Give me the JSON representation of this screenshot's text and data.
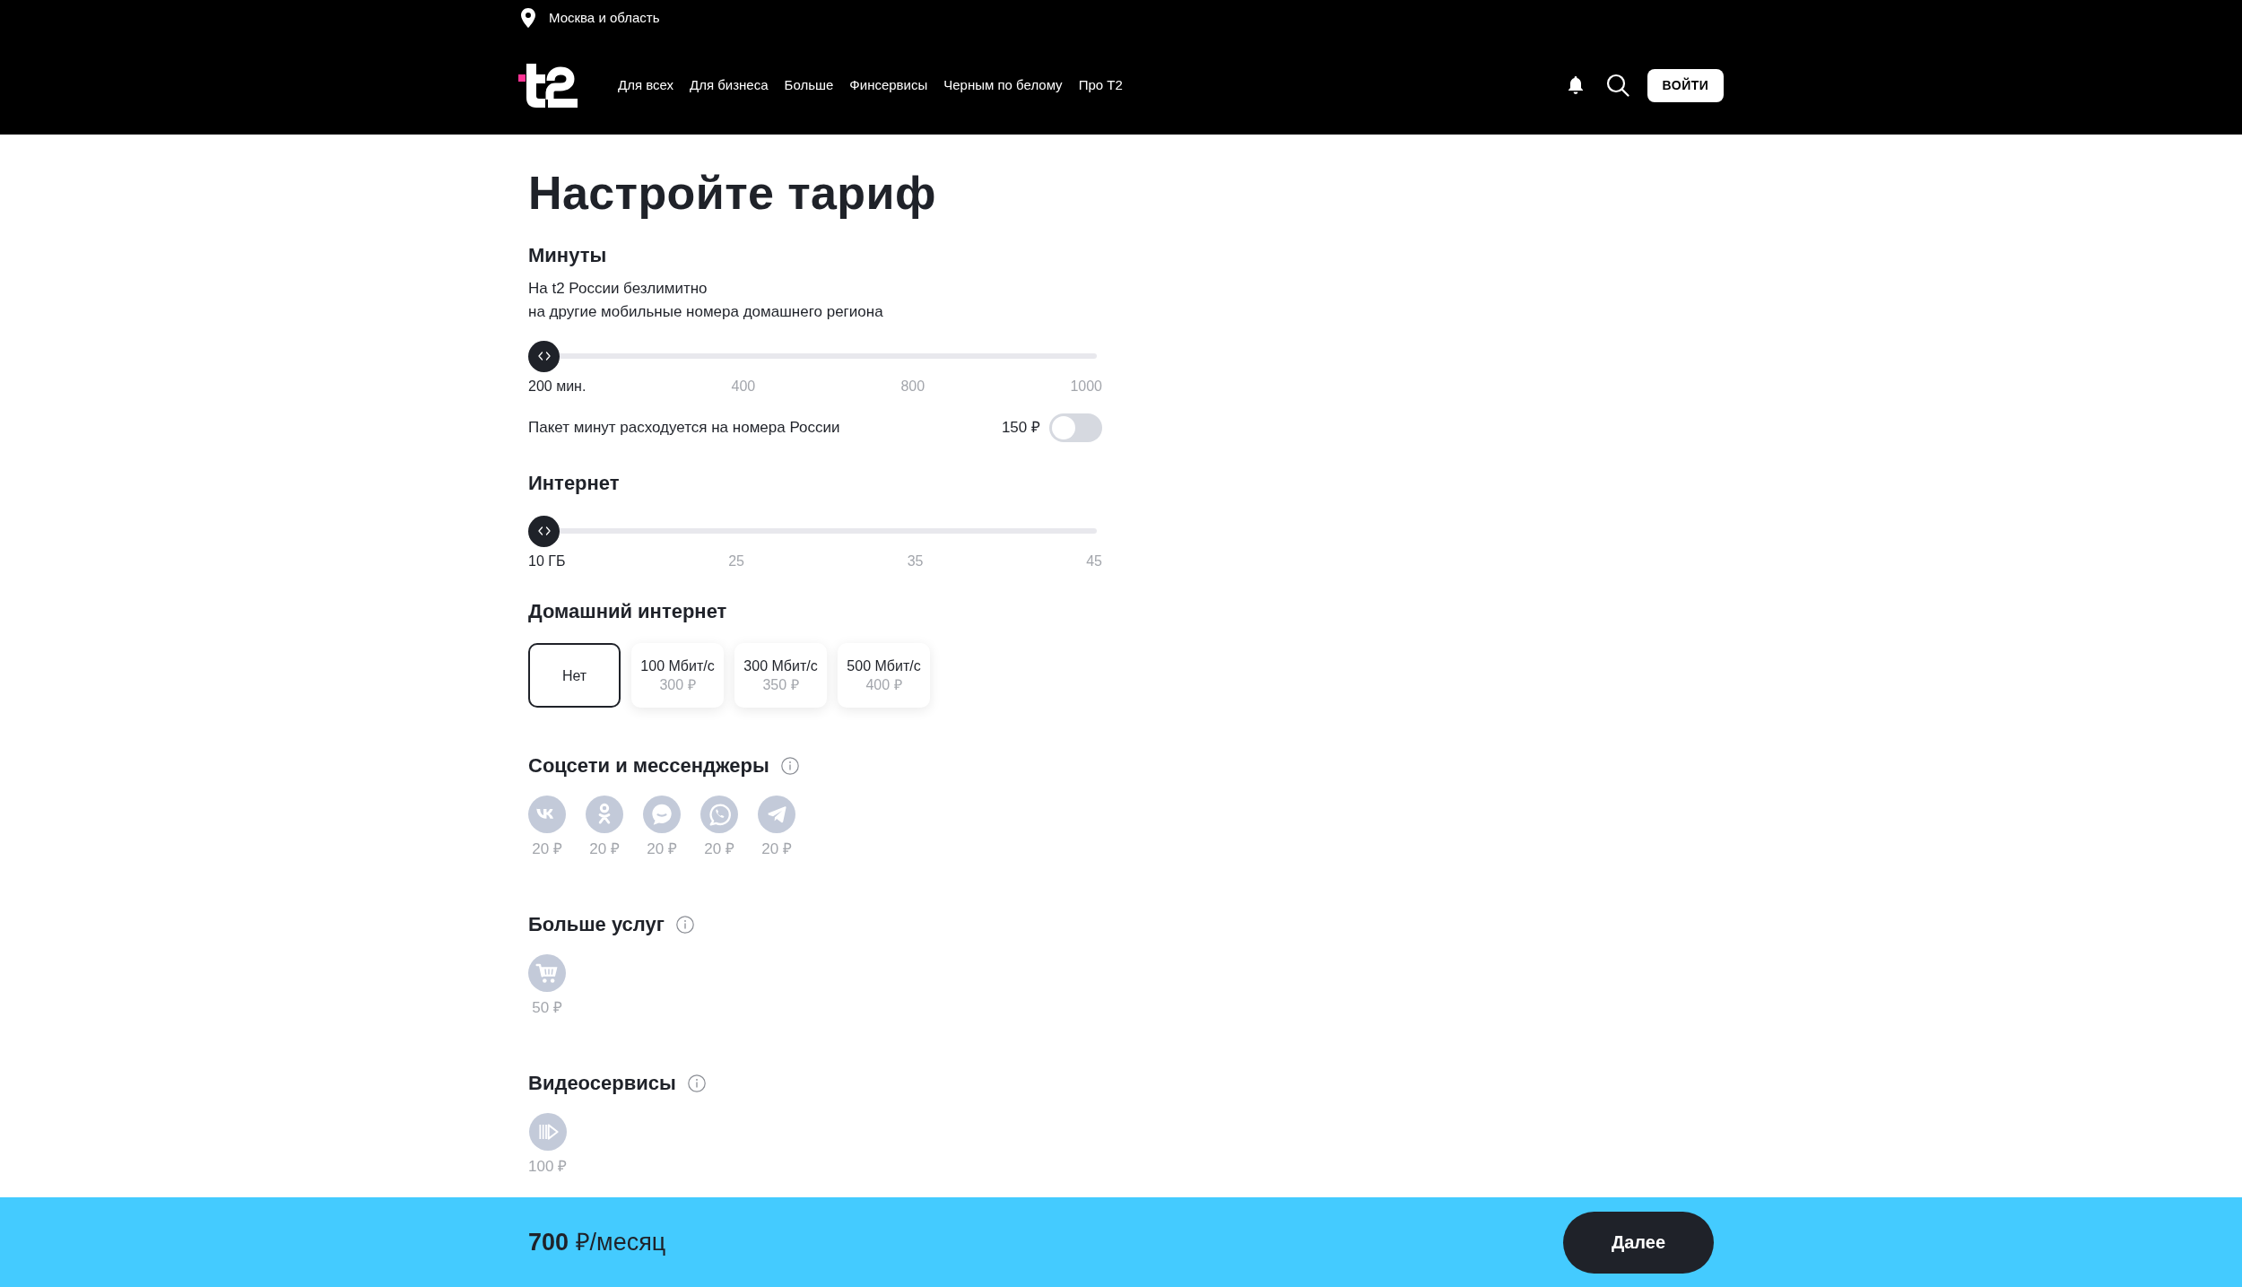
{
  "header": {
    "region": "Москва и область",
    "nav": [
      "Для всех",
      "Для бизнеса",
      "Больше",
      "Финсервисы",
      "Черным по белому",
      "Про T2"
    ],
    "login_button": "ВОЙТИ"
  },
  "title": "Настройте тариф",
  "minutes": {
    "heading": "Минуты",
    "description": [
      "На t2 России безлимитно",
      "на другие мобильные номера домашнего региона"
    ],
    "slider": {
      "level": 0,
      "ticks": [
        {
          "label": "200 мин.",
          "selected": true
        },
        {
          "label": "400",
          "selected": false
        },
        {
          "label": "800",
          "selected": false
        },
        {
          "label": "1000",
          "selected": false
        }
      ]
    },
    "option": {
      "label": "Пакет минут расходуется на номера России",
      "price": "150 ₽",
      "on": false
    }
  },
  "internet": {
    "heading": "Интернет",
    "slider": {
      "level": 0,
      "ticks": [
        {
          "label": "10 ГБ",
          "selected": true
        },
        {
          "label": "25",
          "selected": false
        },
        {
          "label": "35",
          "selected": false
        },
        {
          "label": "45",
          "selected": false
        }
      ]
    }
  },
  "home_internet": {
    "heading": "Домашний интернет",
    "options": [
      {
        "label": "Нет",
        "selected": true
      },
      {
        "label": "100 Мбит/с",
        "price": "300 ₽",
        "selected": false
      },
      {
        "label": "300 Мбит/с",
        "price": "350 ₽",
        "selected": false
      },
      {
        "label": "500 Мбит/с",
        "price": "400 ₽",
        "selected": false
      }
    ]
  },
  "addon_groups": [
    {
      "heading": "Соцсети и мессенджеры",
      "items": [
        {
          "kind": "letters",
          "price": "20 ₽",
          "selected": false
        },
        {
          "kind": "figure",
          "price": "20 ₽",
          "selected": false
        },
        {
          "kind": "bubble",
          "price": "20 ₽",
          "selected": false
        },
        {
          "kind": "phone",
          "price": "20 ₽",
          "selected": false
        },
        {
          "kind": "plane",
          "price": "20 ₽",
          "selected": false
        }
      ]
    },
    {
      "heading": "Больше услуг",
      "items": [
        {
          "kind": "cart",
          "price": "50 ₽",
          "selected": false
        }
      ]
    },
    {
      "heading": "Видеосервисы",
      "items": [
        {
          "kind": "play",
          "price": "100 ₽",
          "selected": false
        }
      ]
    }
  ],
  "footer": {
    "total": "**700** ₽/месяц",
    "button": "Далее"
  }
}
